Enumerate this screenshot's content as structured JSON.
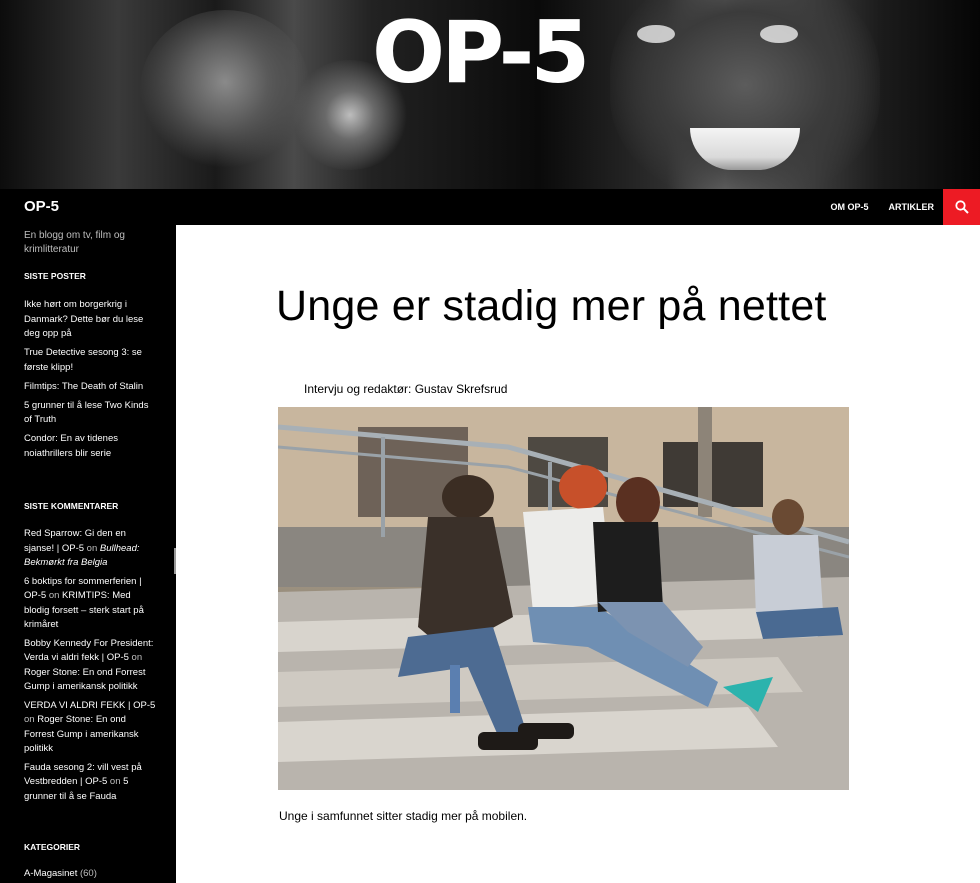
{
  "header": {
    "logo_text": "OP-5",
    "site_title": "OP-5",
    "nav": [
      {
        "label": "OM OP-5"
      },
      {
        "label": "ARTIKLER"
      }
    ],
    "search_icon": "search-icon"
  },
  "sidebar": {
    "tagline": "En blogg om tv, film og krimlitteratur",
    "recent_posts_title": "SISTE POSTER",
    "recent_posts": [
      "Ikke hørt om borgerkrig i Danmark? Dette bør du lese deg opp på",
      "True Detective sesong 3: se første klipp!",
      "Filmtips: The Death of Stalin",
      "5 grunner til å lese Two Kinds of Truth",
      "Condor: En av tidenes noiathrillers blir serie"
    ],
    "recent_comments_title": "SISTE KOMMENTARER",
    "recent_comments": [
      {
        "author": "Red Sparrow: Gi den en sjanse! | OP-5",
        "on": "on",
        "post": "Bullhead: Bekmørkt fra Belgia"
      },
      {
        "author": "6 boktips for sommerferien | OP-5",
        "on": "on",
        "post": "KRIMTIPS: Med blodig forsett – sterk start på krimåret"
      },
      {
        "author": "Bobby Kennedy For President: Verda vi aldri fekk | OP-5",
        "on": "on",
        "post": "Roger Stone: En ond Forrest Gump i amerikansk politikk"
      },
      {
        "author": "VERDA VI ALDRI FEKK | OP-5",
        "on": "on",
        "post": "Roger Stone: En ond Forrest Gump i amerikansk politikk"
      },
      {
        "author": "Fauda sesong 2: vill vest på Vestbredden | OP-5",
        "on": "on",
        "post": "5 grunner til å se Fauda"
      }
    ],
    "categories_title": "KATEGORIER",
    "categories": [
      {
        "name": "A-Magasinet",
        "count": "(60)"
      }
    ]
  },
  "article": {
    "title": "Unge er stadig mer på nettet",
    "byline": "Intervju og redaktør: Gustav Skrefsrud",
    "caption": "Unge i samfunnet sitter stadig mer på mobilen."
  },
  "colors": {
    "accent": "#ed1b24",
    "bar": "#000000"
  }
}
